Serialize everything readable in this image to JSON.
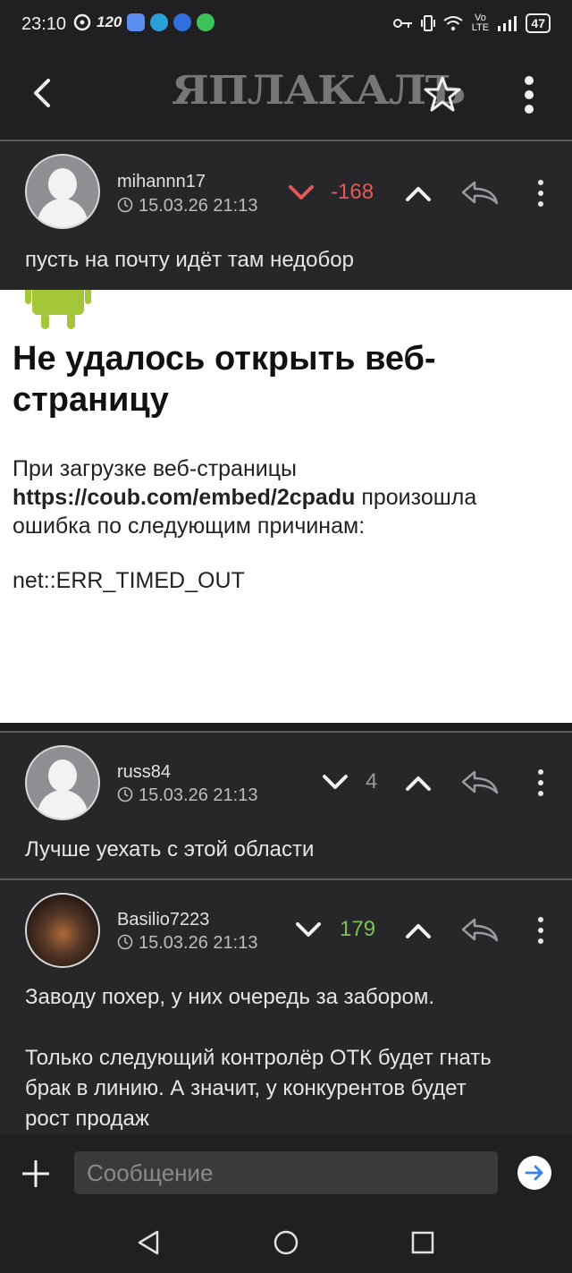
{
  "status_bar": {
    "time": "23:10",
    "refresh_rate": "120",
    "battery": "47",
    "network": "Vo LTE"
  },
  "toolbar": {
    "logo": "ЯПЛАКАЛЪ"
  },
  "comments": [
    {
      "username": "mihannn17",
      "timestamp": "15.03.26 21:13",
      "score": "-168",
      "score_color": "#e05a5a",
      "text": "пусть на почту идёт там недобор"
    },
    {
      "username": "russ84",
      "timestamp": "15.03.26 21:13",
      "score": "4",
      "score_color": "#9a9a9e",
      "text": "Лучше уехать с этой области"
    },
    {
      "username": "Basilio7223",
      "timestamp": "15.03.26 21:13",
      "score": "179",
      "score_color": "#7fbf5a",
      "text_p1": "Заводу похер, у них очередь за забором.",
      "text_p2_line1": "Только следующий контролёр ОТК будет гнать",
      "text_p2_line2": "брак в линию. А значит, у конкурентов будет",
      "text_p2_line3": "рост продаж"
    }
  ],
  "webview_error": {
    "title_line1": "Не удалось открыть веб-",
    "title_line2": "страницу",
    "body_line1": "При загрузке веб-страницы",
    "url": "https://coub.com/embed/2cpadu",
    "body_after_url": " произошла",
    "body_line3": "ошибка по следующим причинам:",
    "error_code": "net::ERR_TIMED_OUT"
  },
  "composer": {
    "placeholder": "Сообщение"
  }
}
